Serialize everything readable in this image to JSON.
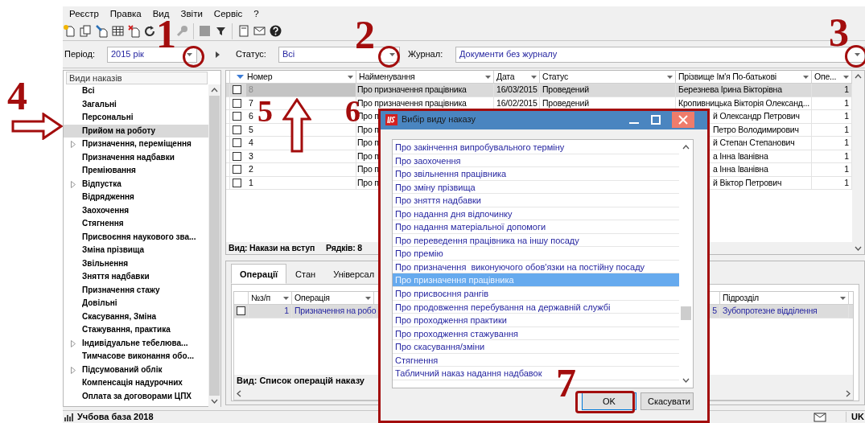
{
  "menu": [
    "Реєстр",
    "Правка",
    "Вид",
    "Звіти",
    "Сервіс",
    "?"
  ],
  "filters": {
    "period": {
      "label": "Період:",
      "value": "2015 рік"
    },
    "status": {
      "label": "Статус:",
      "value": "Всі"
    },
    "journal": {
      "label": "Журнал:",
      "value": "Документи без журналу"
    }
  },
  "order_types": {
    "title": "Види наказів",
    "items": [
      {
        "label": "Всі",
        "expandable": false,
        "selected": false
      },
      {
        "label": "Загальні",
        "expandable": false,
        "selected": false
      },
      {
        "label": "Персональні",
        "expandable": false,
        "selected": false
      },
      {
        "label": "Прийом на роботу",
        "expandable": false,
        "selected": true
      },
      {
        "label": "Призначення, переміщення",
        "expandable": true,
        "selected": false
      },
      {
        "label": "Призначення надбавки",
        "expandable": false,
        "selected": false
      },
      {
        "label": "Преміювання",
        "expandable": false,
        "selected": false
      },
      {
        "label": "Відпустка",
        "expandable": true,
        "selected": false
      },
      {
        "label": "Відрядження",
        "expandable": false,
        "selected": false
      },
      {
        "label": "Заохочення",
        "expandable": false,
        "selected": false
      },
      {
        "label": "Стягнення",
        "expandable": false,
        "selected": false
      },
      {
        "label": "Присвоєння наукового зва...",
        "expandable": false,
        "selected": false
      },
      {
        "label": "Зміна прізвища",
        "expandable": false,
        "selected": false
      },
      {
        "label": "Звільнення",
        "expandable": false,
        "selected": false
      },
      {
        "label": "Зняття надбавки",
        "expandable": false,
        "selected": false
      },
      {
        "label": "Призначення стажу",
        "expandable": false,
        "selected": false
      },
      {
        "label": "Довільні",
        "expandable": false,
        "selected": false
      },
      {
        "label": "Скасування, Зміна",
        "expandable": false,
        "selected": false
      },
      {
        "label": "Стажування, практика",
        "expandable": false,
        "selected": false
      },
      {
        "label": "Індивідуальне тебелюва...",
        "expandable": true,
        "selected": false
      },
      {
        "label": "Тимчасове виконання обо...",
        "expandable": false,
        "selected": false
      },
      {
        "label": "Підсумований облік",
        "expandable": true,
        "selected": false
      },
      {
        "label": "Компенсація надурочних",
        "expandable": false,
        "selected": false
      },
      {
        "label": "Оплата за договорами ЦПХ",
        "expandable": false,
        "selected": false
      }
    ]
  },
  "orders_table": {
    "columns": [
      {
        "label": "Номер",
        "sorted": true
      },
      {
        "label": "Найменування",
        "sorted": false
      },
      {
        "label": "Дата",
        "sorted": false
      },
      {
        "label": "Статус",
        "sorted": false
      },
      {
        "label": "Прізвище Ім'я По-батькові",
        "sorted": false
      },
      {
        "label": "Опе...",
        "sorted": false
      }
    ],
    "rows": [
      {
        "checked": false,
        "selected": true,
        "number": "8",
        "name": "Про призначення працівника",
        "date": "16/03/2015",
        "status": "Проведений",
        "full_name": {
          "text": "Березнева Ірина Вікторівна",
          "covered": false
        },
        "column_7": "1"
      },
      {
        "checked": false,
        "selected": false,
        "number": "7",
        "name": "Про призначення працівника",
        "date": "16/02/2015",
        "status": "Проведений",
        "full_name": {
          "text": "Кропивницька Вікторія Олександ...",
          "covered": false
        },
        "column_7": "1"
      },
      {
        "checked": false,
        "selected": false,
        "number": "6",
        "name": "Про п",
        "full_name": {
          "text": "й Олександр Петрович",
          "covered": true
        },
        "column_7": "1"
      },
      {
        "checked": false,
        "selected": false,
        "number": "5",
        "name": "Про п",
        "full_name": {
          "text": "Петро Володимирович",
          "covered": true
        },
        "column_7": "1"
      },
      {
        "checked": false,
        "selected": false,
        "number": "4",
        "name": "Про п",
        "full_name": {
          "text": "й Степан Степанович",
          "covered": true
        },
        "column_7": "1"
      },
      {
        "checked": false,
        "selected": false,
        "number": "3",
        "name": "Про п",
        "full_name": {
          "text": "а Інна Іванівна",
          "covered": true
        },
        "column_7": "1"
      },
      {
        "checked": false,
        "selected": false,
        "number": "2",
        "name": "Про п",
        "full_name": {
          "text": "а Інна Іванівна",
          "covered": true
        },
        "column_7": "1"
      },
      {
        "checked": false,
        "selected": false,
        "number": "1",
        "name": "Про п",
        "full_name": {
          "text": "й Віктор Петрович",
          "covered": true
        },
        "column_7": "1"
      }
    ],
    "footer": {
      "view": "Вид: Накази на вступ",
      "count": "Рядків: 8"
    }
  },
  "detail_tabs": [
    {
      "label": "Операції",
      "selected": true
    },
    {
      "label": "Стан",
      "selected": false
    },
    {
      "label": "Універсал",
      "selected": false
    }
  ],
  "operations_table": {
    "columns": [
      "№з/п",
      "Операція",
      "Підрозділ"
    ],
    "rows": [
      {
        "checked": false,
        "selected": true,
        "number": "1",
        "operation": "Призначення на робо",
        "column_3": "5",
        "department": "Зубопротезне відділення"
      }
    ],
    "footer": "Вид: Список операцій наказу"
  },
  "dialog": {
    "title": "Вибір виду наказу",
    "items": [
      {
        "label": "Про закінчення випробувального терміну",
        "selected": false
      },
      {
        "label": "Про заохочення",
        "selected": false
      },
      {
        "label": "Про звільнення працівника",
        "selected": false
      },
      {
        "label": "Про зміну прізвища",
        "selected": false
      },
      {
        "label": "Про зняття надбавки",
        "selected": false
      },
      {
        "label": "Про надання дня відпочинку",
        "selected": false
      },
      {
        "label": "Про надання матеріальної допомоги",
        "selected": false
      },
      {
        "label": "Про переведення працівника на іншу посаду",
        "selected": false
      },
      {
        "label": "Про премію",
        "selected": false
      },
      {
        "label": "Про призначення  виконуючого обов'язки на постійну посаду",
        "selected": false
      },
      {
        "label": "Про призначення працівника",
        "selected": true
      },
      {
        "label": "Про присвоєння рангів",
        "selected": false
      },
      {
        "label": "Про продовження перебування на державній службі",
        "selected": false
      },
      {
        "label": "Про проходження практики",
        "selected": false
      },
      {
        "label": "Про проходження стажування",
        "selected": false
      },
      {
        "label": "Про скасування/зміни",
        "selected": false
      },
      {
        "label": "Стягнення",
        "selected": false
      },
      {
        "label": "Табличний наказ надання надбавок",
        "selected": false
      }
    ],
    "buttons": [
      {
        "label": "OK",
        "kind": "default"
      },
      {
        "label": "Скасувати",
        "kind": "normal"
      }
    ]
  },
  "status_bar": {
    "database": "Учбова база 2018",
    "language": "UK"
  },
  "annotations": [
    {
      "label": "1",
      "kind": "circle"
    },
    {
      "label": "2",
      "kind": "circle"
    },
    {
      "label": "3",
      "kind": "circle"
    },
    {
      "label": "4",
      "kind": "right-arrow"
    },
    {
      "label": "5",
      "kind": "up-arrow"
    },
    {
      "label": "6",
      "kind": "frame"
    },
    {
      "label": "7",
      "kind": "frame"
    }
  ]
}
